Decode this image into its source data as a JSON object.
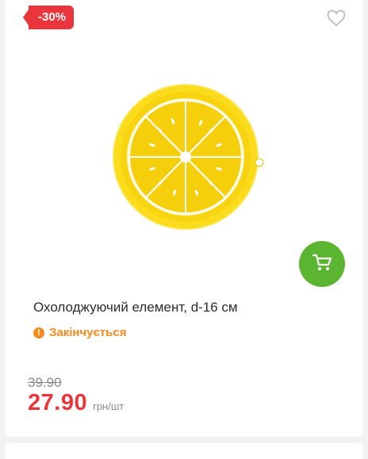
{
  "product": {
    "discount_badge": "-30%",
    "title": "Охолоджуючий елемент, d-16 см",
    "status": "Закінчується",
    "old_price": "39.90",
    "price": "27.90",
    "unit": "грн/шт",
    "image_alt": "Yellow lemon slice cooling element"
  },
  "icons": {
    "favorite": "heart-icon",
    "cart": "cart-icon",
    "status": "warning-icon"
  },
  "colors": {
    "badge": "#e8363c",
    "price": "#e8363c",
    "cart_button": "#5cb531",
    "status": "#f28b1d"
  }
}
